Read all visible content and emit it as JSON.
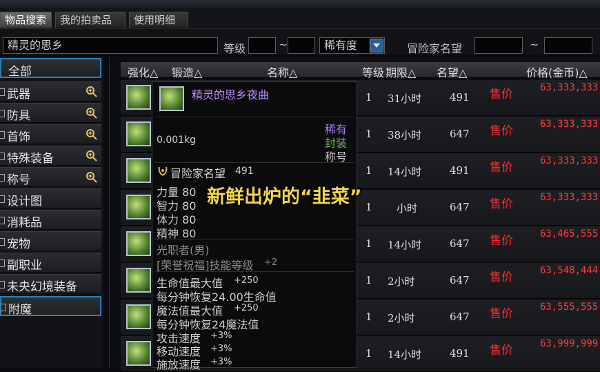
{
  "tabs": [
    {
      "label": "物品搜索"
    },
    {
      "label": "我的拍卖品"
    },
    {
      "label": "使用明细"
    }
  ],
  "filters": {
    "search_value": "精灵的思乡",
    "level_label": "等级",
    "level_sep": "~",
    "rarity_value": "稀有度",
    "fame_label": "冒险家名望",
    "fame_sep": "~"
  },
  "categories": [
    {
      "label": "全部",
      "expandable": false
    },
    {
      "label": "武器",
      "expandable": true
    },
    {
      "label": "防具",
      "expandable": true
    },
    {
      "label": "首饰",
      "expandable": true
    },
    {
      "label": "特殊装备",
      "expandable": true
    },
    {
      "label": "称号",
      "expandable": true
    },
    {
      "label": "设计图",
      "expandable": false
    },
    {
      "label": "消耗品",
      "expandable": false
    },
    {
      "label": "宠物",
      "expandable": false
    },
    {
      "label": "副职业",
      "expandable": false
    },
    {
      "label": "未央幻境装备",
      "expandable": false
    },
    {
      "label": "附魔",
      "expandable": false
    }
  ],
  "columns": {
    "enhance": "强化△",
    "forge": "锻造△",
    "name": "名称△",
    "level": "等级",
    "duration": "期限△",
    "fame": "名望△",
    "price": "价格(金币)△"
  },
  "rows": [
    {
      "level": "1",
      "duration": "31小时",
      "fame": "491",
      "sell": "售价",
      "price": "63,333,333"
    },
    {
      "level": "1",
      "duration": "38小时",
      "fame": "647",
      "sell": "售价",
      "price": "63,333,333"
    },
    {
      "level": "1",
      "duration": "14小时",
      "fame": "491",
      "sell": "售价",
      "price": "63,333,333"
    },
    {
      "level": "1",
      "duration": "小时",
      "fame": "647",
      "sell": "售价",
      "price": "63,333,333"
    },
    {
      "level": "1",
      "duration": "14小时",
      "fame": "647",
      "sell": "售价",
      "price": "63,465,555"
    },
    {
      "level": "1",
      "duration": "2小时",
      "fame": "647",
      "sell": "售价",
      "price": "63,548,444"
    },
    {
      "level": "1",
      "duration": "2小时",
      "fame": "647",
      "sell": "售价",
      "price": "63,555,555"
    },
    {
      "level": "1",
      "duration": "14小时",
      "fame": "491",
      "sell": "售价",
      "price": "63,999,999"
    }
  ],
  "tooltip": {
    "item_name": "精灵的思乡夜曲",
    "weight": "0.001kg",
    "rarity": "稀有",
    "sealed": "封装",
    "type": "称号",
    "fame_line": "冒险家名望",
    "fame_value": "491",
    "stats": [
      "力量 80",
      "智力 80",
      "体力 80",
      "精神 80"
    ],
    "class_line": "光职者(男)",
    "skill_line": "[荣誉祝福]技能等级",
    "skill_value": "+2",
    "effects": [
      "生命值最大值",
      "每分钟恢复24.00生命值",
      "魔法值最大值",
      "每分钟恢复24魔法值",
      "攻击速度",
      "移动速度",
      "施放速度"
    ],
    "effect_values": [
      "+250",
      "",
      "+250",
      "",
      "+3%",
      "+3%",
      "+3%"
    ]
  },
  "overlay_caption": "新鲜出炉的“韭菜”",
  "colors": {
    "sell": "#ff2e2e",
    "item_name": "#b98cff",
    "rarity": "#a77bff",
    "sealed": "#6fbf5a",
    "overlay": "#f3d64b"
  }
}
